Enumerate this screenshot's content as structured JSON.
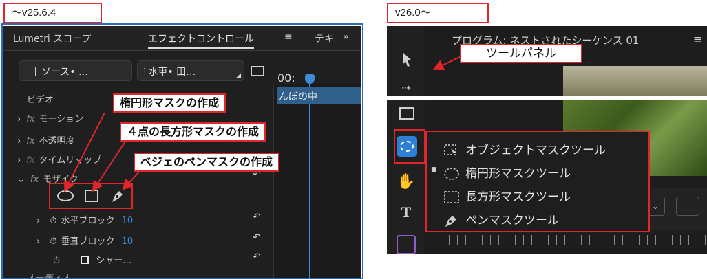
{
  "versions": {
    "old": "～v25.6.4",
    "new": "v26.0～"
  },
  "left_panel": {
    "tabs": [
      "Lumetri スコープ",
      "エフェクトコントロール",
      "テキ"
    ],
    "menu_glyph": "≡",
    "overflow_glyph": "»",
    "source_button": "ソース• …",
    "clip_button": "水車• 田…",
    "timecode": "00:",
    "clip_label": "んぼの中",
    "section_video": "ビデオ",
    "section_audio": "オーディオ",
    "properties": [
      {
        "label": "モーション",
        "fx": "fx"
      },
      {
        "label": "不透明度",
        "fx": "fx"
      },
      {
        "label": "タイムリマップ",
        "fx": "fx"
      },
      {
        "label": "モザイク",
        "fx": "fx"
      }
    ],
    "sub_properties": [
      {
        "label": "水平ブロック",
        "value": "10"
      },
      {
        "label": "垂直ブロック",
        "value": "10"
      },
      {
        "label": "シャー…",
        "value": ""
      }
    ]
  },
  "callouts": {
    "ellipse": "楕円形マスクの作成",
    "rect": "４点の長方形マスクの作成",
    "pen": "ベジェのペンマスクの作成",
    "tool_panel": "ツールパネル"
  },
  "right_top": {
    "title": "プログラム: ネストされたシーケンス 01",
    "menu_glyph": "≡"
  },
  "mask_menu": {
    "items": [
      "オブジェクトマスクツール",
      "楕円形マスクツール",
      "長方形マスクツール",
      "ペンマスクツール"
    ],
    "selected_index": 1
  },
  "colors": {
    "accent_red": "#e0262b",
    "tool_blue": "#2e7fd6",
    "panel_bg": "#1f1f1f"
  }
}
